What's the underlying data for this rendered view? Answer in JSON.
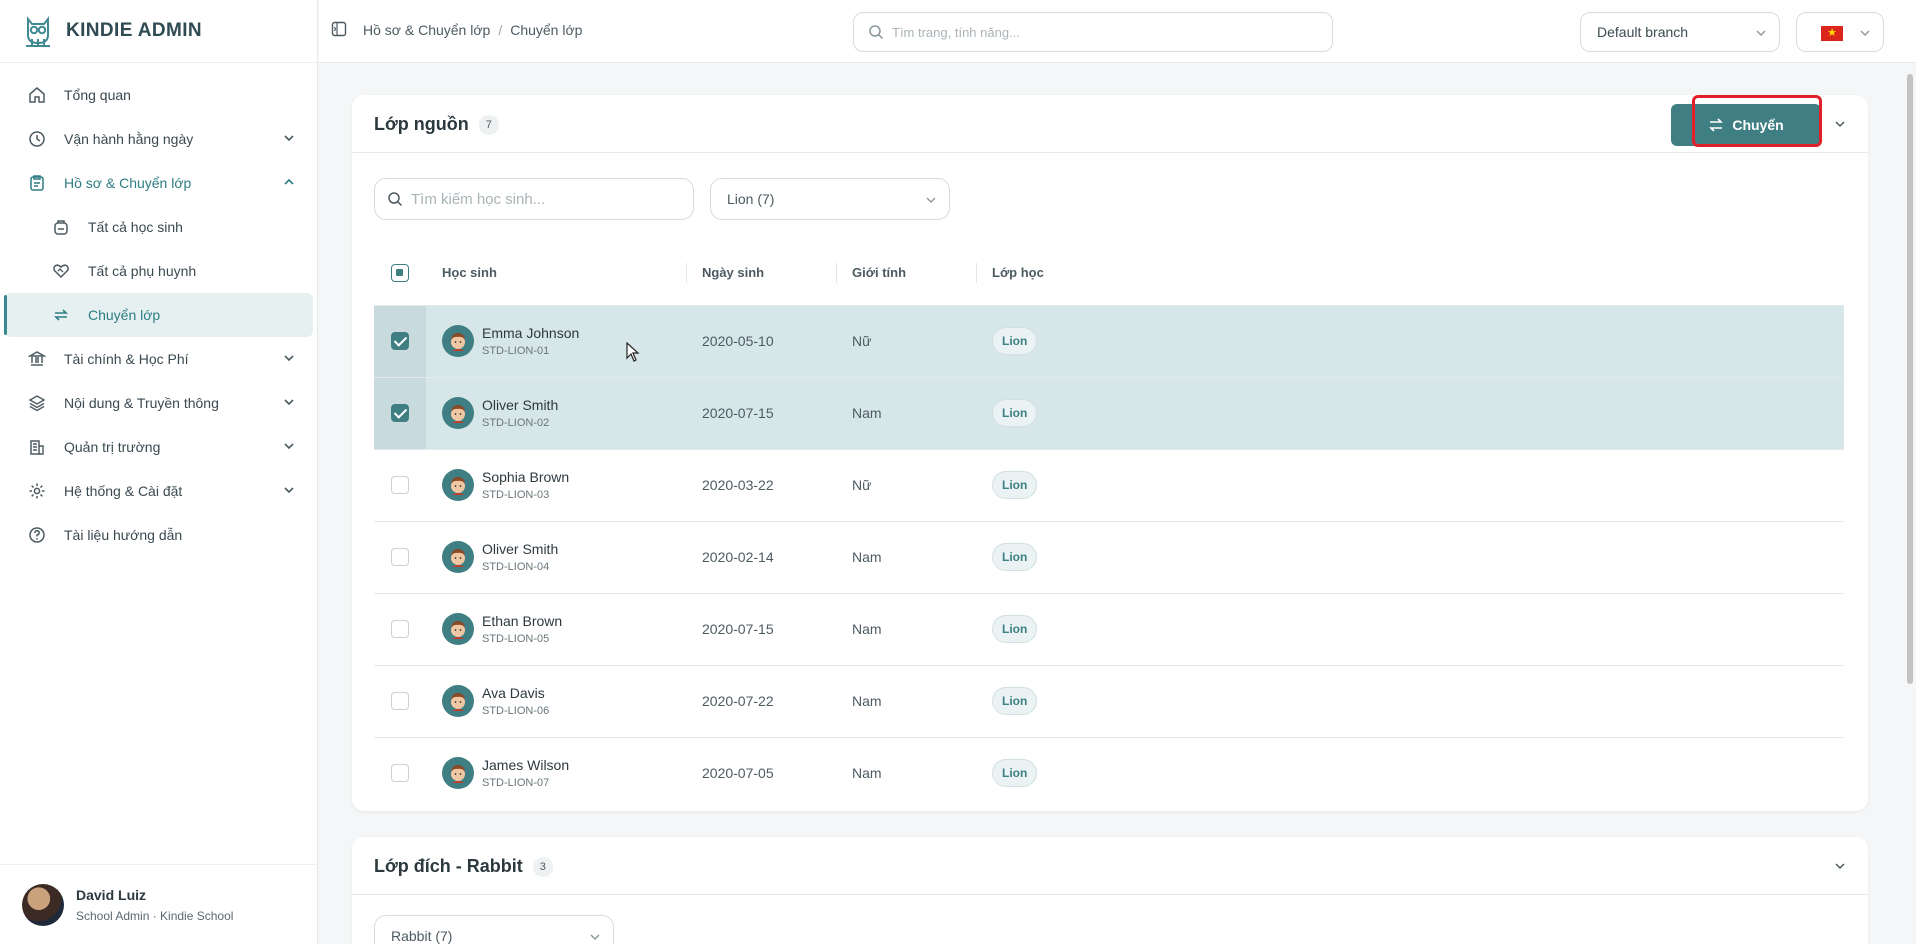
{
  "app": {
    "name": "KINDIE ADMIN"
  },
  "sidebar": {
    "items": [
      {
        "label": "Tổng quan"
      },
      {
        "label": "Vận hành hằng ngày"
      },
      {
        "label": "Hồ sơ & Chuyển lớp"
      },
      {
        "label": "Tài chính & Học Phí"
      },
      {
        "label": "Nội dung & Truyền thông"
      },
      {
        "label": "Quản trị trường"
      },
      {
        "label": "Hệ thống & Cài đặt"
      },
      {
        "label": "Tài liệu hướng dẫn"
      }
    ],
    "sub_items": [
      {
        "label": "Tất cả học sinh"
      },
      {
        "label": "Tất cả phụ huynh"
      },
      {
        "label": "Chuyển lớp"
      }
    ],
    "user": {
      "name": "David Luiz",
      "role": "School Admin · Kindie School"
    }
  },
  "header": {
    "breadcrumb": [
      "Hồ sơ & Chuyển lớp",
      "Chuyển lớp"
    ],
    "breadcrumb_sep": "/",
    "search_placeholder": "Tìm trang, tính năng...",
    "branch": "Default branch",
    "language_flag": "★"
  },
  "source": {
    "title": "Lớp nguồn",
    "count": "7",
    "transfer_label": "Chuyển",
    "search_placeholder": "Tìm kiếm học sinh...",
    "class_filter": "Lion (7)",
    "columns": [
      "Học sinh",
      "Ngày sinh",
      "Giới tính",
      "Lớp học"
    ],
    "rows": [
      {
        "name": "Emma Johnson",
        "code": "STD-LION-01",
        "dob": "2020-05-10",
        "gender": "Nữ",
        "class": "Lion",
        "selected": true
      },
      {
        "name": "Oliver Smith",
        "code": "STD-LION-02",
        "dob": "2020-07-15",
        "gender": "Nam",
        "class": "Lion",
        "selected": true
      },
      {
        "name": "Sophia Brown",
        "code": "STD-LION-03",
        "dob": "2020-03-22",
        "gender": "Nữ",
        "class": "Lion",
        "selected": false
      },
      {
        "name": "Oliver Smith",
        "code": "STD-LION-04",
        "dob": "2020-02-14",
        "gender": "Nam",
        "class": "Lion",
        "selected": false
      },
      {
        "name": "Ethan Brown",
        "code": "STD-LION-05",
        "dob": "2020-07-15",
        "gender": "Nam",
        "class": "Lion",
        "selected": false
      },
      {
        "name": "Ava Davis",
        "code": "STD-LION-06",
        "dob": "2020-07-22",
        "gender": "Nam",
        "class": "Lion",
        "selected": false
      },
      {
        "name": "James Wilson",
        "code": "STD-LION-07",
        "dob": "2020-07-05",
        "gender": "Nam",
        "class": "Lion",
        "selected": false
      }
    ]
  },
  "target": {
    "title": "Lớp đích - Rabbit",
    "count": "3",
    "class_filter": "Rabbit (7)"
  },
  "colors": {
    "accent": "#3f7f84",
    "highlight": "#e0202a",
    "selected_row": "#d7e6e8"
  }
}
